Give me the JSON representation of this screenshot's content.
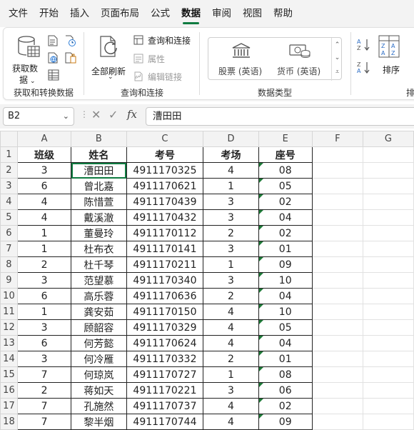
{
  "menu": [
    "文件",
    "开始",
    "插入",
    "页面布局",
    "公式",
    "数据",
    "审阅",
    "视图",
    "帮助"
  ],
  "active_menu": "数据",
  "ribbon": {
    "get_data_line1": "获取数",
    "get_data_line2": "据",
    "refresh_all": "全部刷新",
    "query_connect": "查询和连接",
    "properties": "属性",
    "edit_links": "编辑链接",
    "stocks": "股票 (英语)",
    "currency": "货币 (英语)",
    "sort": "排序",
    "group_get": "获取和转换数据",
    "group_query": "查询和连接",
    "group_dtype": "数据类型",
    "group_sort_cut": "排"
  },
  "formula_bar": {
    "name_box": "B2",
    "fx": "fx",
    "value": "漕田田"
  },
  "sheet": {
    "columns": [
      "A",
      "B",
      "C",
      "D",
      "E",
      "F",
      "G"
    ],
    "rows": [
      [
        "班级",
        "姓名",
        "考号",
        "考场",
        "座号"
      ],
      [
        "3",
        "漕田田",
        "4911170325",
        "4",
        "08"
      ],
      [
        "6",
        "曾北嘉",
        "4911170621",
        "1",
        "05"
      ],
      [
        "4",
        "陈惜萱",
        "4911170439",
        "3",
        "02"
      ],
      [
        "4",
        "戴溪澈",
        "4911170432",
        "3",
        "04"
      ],
      [
        "1",
        "董曼玲",
        "4911170112",
        "2",
        "02"
      ],
      [
        "1",
        "杜布衣",
        "4911170141",
        "3",
        "01"
      ],
      [
        "2",
        "杜千琴",
        "4911170211",
        "1",
        "09"
      ],
      [
        "3",
        "范望慕",
        "4911170340",
        "3",
        "10"
      ],
      [
        "6",
        "高乐蓉",
        "4911170636",
        "2",
        "04"
      ],
      [
        "1",
        "龚安茹",
        "4911170150",
        "4",
        "10"
      ],
      [
        "3",
        "顾韶容",
        "4911170329",
        "4",
        "05"
      ],
      [
        "6",
        "何芳懿",
        "4911170624",
        "4",
        "04"
      ],
      [
        "3",
        "何冷雁",
        "4911170332",
        "2",
        "01"
      ],
      [
        "7",
        "何琼岚",
        "4911170727",
        "1",
        "08"
      ],
      [
        "2",
        "蒋如天",
        "4911170221",
        "3",
        "06"
      ],
      [
        "7",
        "孔施然",
        "4911170737",
        "4",
        "02"
      ],
      [
        "7",
        "黎半烟",
        "4911170744",
        "4",
        "09"
      ]
    ]
  }
}
